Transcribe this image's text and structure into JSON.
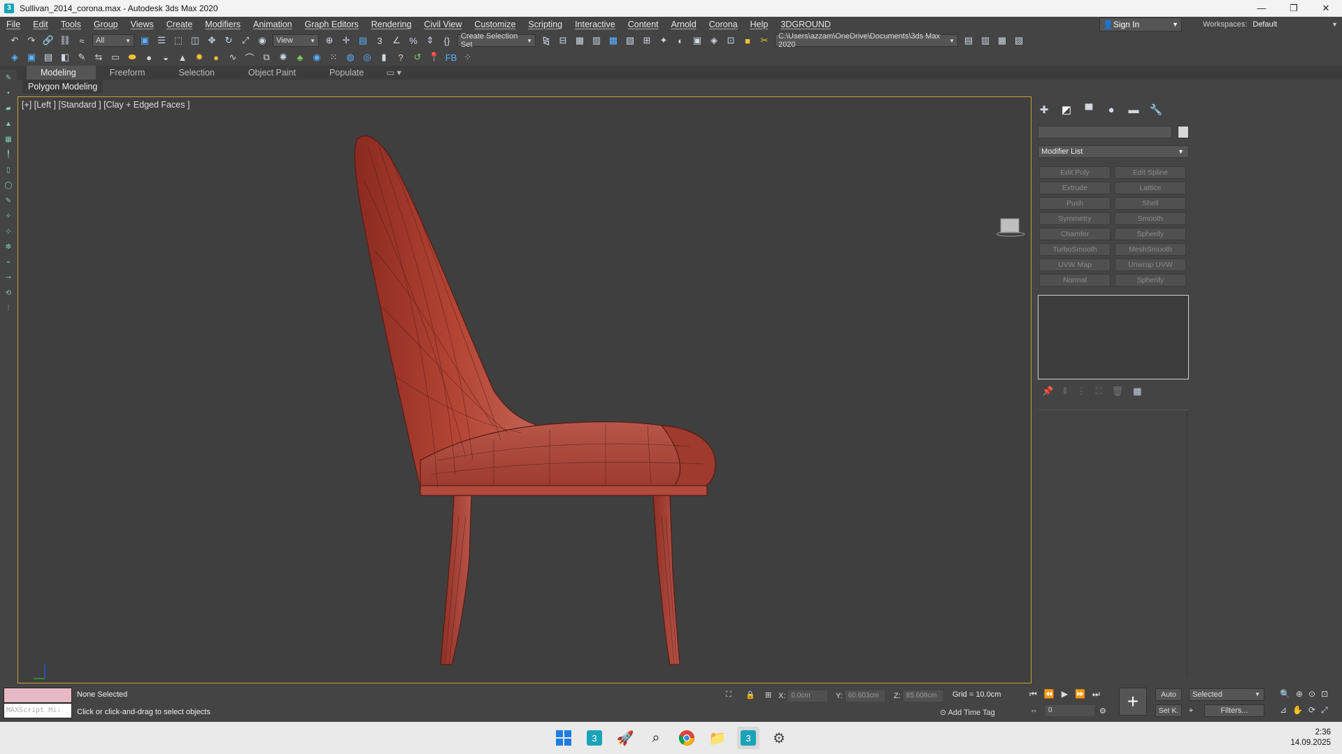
{
  "window": {
    "title": "Sullivan_2014_corona.max - Autodesk 3ds Max 2020",
    "app_icon": "3",
    "controls": [
      "—",
      "❐",
      "✕"
    ]
  },
  "menu": [
    "File",
    "Edit",
    "Tools",
    "Group",
    "Views",
    "Create",
    "Modifiers",
    "Animation",
    "Graph Editors",
    "Rendering",
    "Civil View",
    "Customize",
    "Scripting",
    "Interactive",
    "Content",
    "Arnold",
    "Corona",
    "Help",
    "3DGROUND"
  ],
  "account": {
    "sign_in": "Sign In",
    "workspaces_label": "Workspaces:",
    "workspace": "Default"
  },
  "toolbar": {
    "filter": "All",
    "ref_coord": "View",
    "selection_set": "Create Selection Set",
    "project_path": "C:\\Users\\azzam\\OneDrive\\Documents\\3ds Max 2020"
  },
  "ribbon": {
    "tabs": [
      "Modeling",
      "Freeform",
      "Selection",
      "Object Paint",
      "Populate"
    ],
    "active_tab": "Modeling",
    "subtab": "Polygon Modeling"
  },
  "viewport": {
    "label": "[+] [Left ] [Standard ] [Clay + Edged Faces ]"
  },
  "command_panel": {
    "modifier_list": "Modifier List",
    "modifiers": [
      "Edit Poly",
      "Edit Spline",
      "Extrude",
      "Lattice",
      "Push",
      "Shell",
      "Symmetry",
      "Smooth",
      "Chamfer",
      "Spherify",
      "TurboSmooth",
      "MeshSmooth",
      "UVW Map",
      "Unwrap UVW",
      "Normal",
      "Spherify"
    ]
  },
  "status": {
    "maxscript": "MAXScript Mi:",
    "selection": "None Selected",
    "hint": "Click or click-and-drag to select objects",
    "x_label": "X:",
    "x_value": "0.0cm",
    "y_label": "Y:",
    "y_value": "60.603cm",
    "z_label": "Z:",
    "z_value": "85.608cm",
    "grid": "Grid = 10.0cm",
    "add_time_tag": "Add Time Tag",
    "frame": "0",
    "auto_key": "Auto",
    "set_key": "Set K.",
    "key_filter": "Selected",
    "filters": "Filters..."
  },
  "taskbar": {
    "time": "2:36",
    "date": "14.09.2025"
  },
  "colors": {
    "chair": "#a83a2c",
    "viewport_border": "#c9a23a",
    "viewport_bg": "#3f3f3f"
  }
}
